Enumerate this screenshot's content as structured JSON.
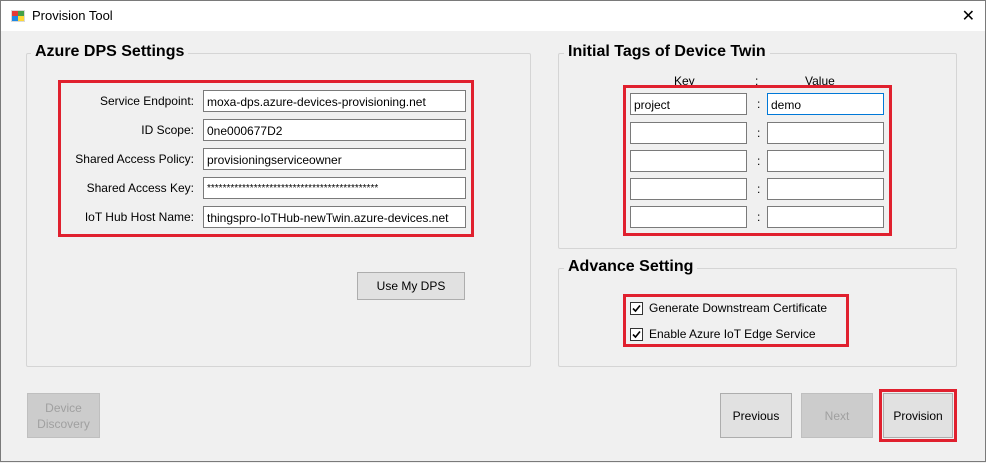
{
  "window": {
    "title": "Provision Tool",
    "close_glyph": "✕"
  },
  "dps": {
    "title": "Azure DPS Settings",
    "fields": [
      {
        "label": "Service Endpoint:",
        "value": "moxa-dps.azure-devices-provisioning.net"
      },
      {
        "label": "ID Scope:",
        "value": "0ne000677D2"
      },
      {
        "label": "Shared Access Policy:",
        "value": "provisioningserviceowner"
      },
      {
        "label": "Shared Access Key:",
        "value": "********************************************"
      },
      {
        "label": "IoT Hub Host Name:",
        "value": "thingspro-IoTHub-newTwin.azure-devices.net"
      }
    ],
    "use_my_dps_label": "Use My DPS"
  },
  "tags": {
    "title": "Initial Tags of Device Twin",
    "key_header": "Key",
    "sep_header": ":",
    "value_header": "Value",
    "rows": [
      {
        "key": "project",
        "sep": ":",
        "value": "demo"
      },
      {
        "key": "",
        "sep": ":",
        "value": ""
      },
      {
        "key": "",
        "sep": ":",
        "value": ""
      },
      {
        "key": "",
        "sep": ":",
        "value": ""
      },
      {
        "key": "",
        "sep": ":",
        "value": ""
      }
    ]
  },
  "advance": {
    "title": "Advance Setting",
    "options": [
      {
        "label": "Generate Downstream Certificate",
        "checked": true
      },
      {
        "label": "Enable Azure IoT Edge Service",
        "checked": true
      }
    ]
  },
  "footer": {
    "device_discovery_label_1": "Device",
    "device_discovery_label_2": "Discovery",
    "previous_label": "Previous",
    "next_label": "Next",
    "provision_label": "Provision"
  },
  "colors": {
    "highlight": "#e0202e",
    "focus_border": "#0078d7"
  }
}
